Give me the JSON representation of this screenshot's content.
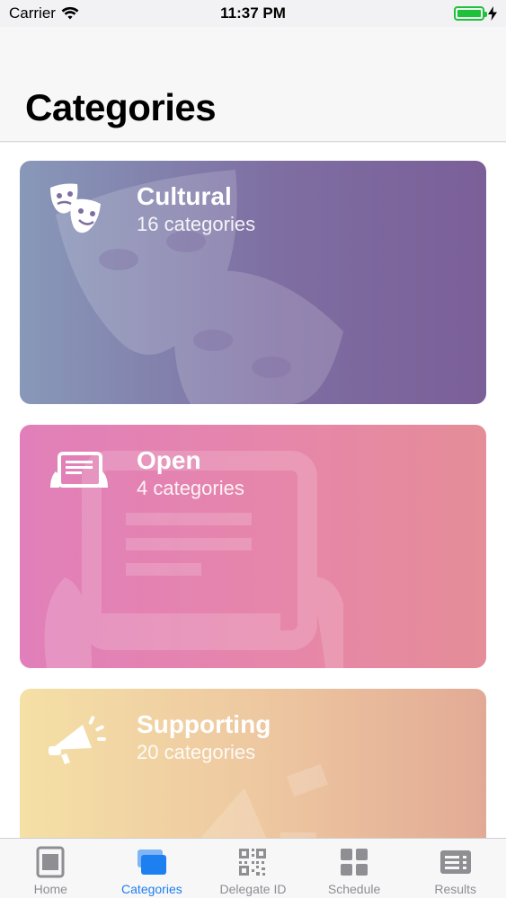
{
  "status_bar": {
    "carrier": "Carrier",
    "time": "11:37 PM",
    "battery_level": 1.0,
    "battery_color": "#1ec23a"
  },
  "header": {
    "title": "Categories"
  },
  "cards": [
    {
      "title": "Cultural",
      "subtitle": "16 categories",
      "icon": "theater-masks-icon"
    },
    {
      "title": "Open",
      "subtitle": "4 categories",
      "icon": "tablet-hands-icon"
    },
    {
      "title": "Supporting",
      "subtitle": "20 categories",
      "icon": "megaphone-icon"
    }
  ],
  "tab_bar": {
    "active_color": "#1d7ff0",
    "inactive_color": "#8e8e93",
    "tabs": [
      {
        "label": "Home",
        "icon": "home-icon",
        "active": false
      },
      {
        "label": "Categories",
        "icon": "categories-icon",
        "active": true
      },
      {
        "label": "Delegate ID",
        "icon": "qr-code-icon",
        "active": false
      },
      {
        "label": "Schedule",
        "icon": "grid-icon",
        "active": false
      },
      {
        "label": "Results",
        "icon": "results-list-icon",
        "active": false
      }
    ]
  }
}
